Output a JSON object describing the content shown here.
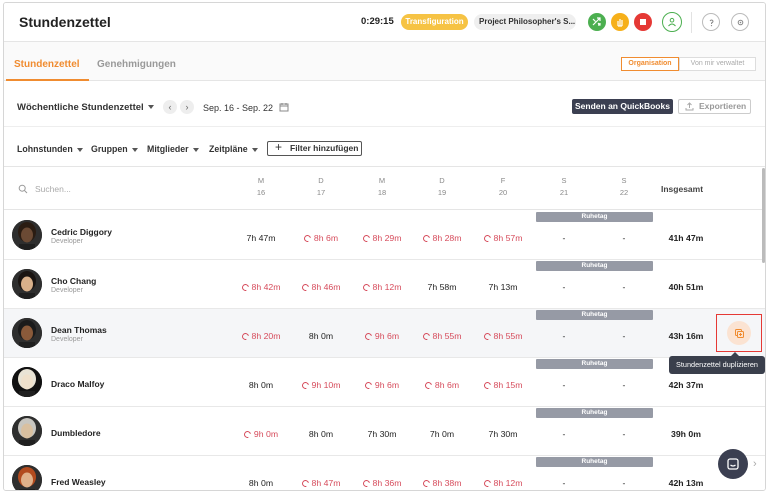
{
  "header": {
    "title": "Stundenzettel",
    "timer": "0:29:15",
    "current_task": "Transfiguration",
    "current_project": "Project Philosopher's S..."
  },
  "tabs": [
    {
      "label": "Stundenzettel",
      "active": true
    },
    {
      "label": "Genehmigungen",
      "active": false
    }
  ],
  "scope_toggle": {
    "options": [
      "Organisation",
      "Von mir verwaltet"
    ],
    "selected": "Organisation"
  },
  "toolbar": {
    "view_select": "Wöchentliche Stundenzettel",
    "date_range": "Sep. 16 - Sep. 22",
    "quickbooks_label": "Senden an QuickBooks",
    "export_label": "Exportieren"
  },
  "filters": {
    "items": [
      "Lohnstunden",
      "Gruppen",
      "Mitglieder",
      "Zeitpläne"
    ],
    "add_label": "Filter hinzufügen"
  },
  "table": {
    "search_placeholder": "Suchen...",
    "days": [
      {
        "letter": "M",
        "num": "16"
      },
      {
        "letter": "D",
        "num": "17"
      },
      {
        "letter": "M",
        "num": "18"
      },
      {
        "letter": "D",
        "num": "19"
      },
      {
        "letter": "F",
        "num": "20"
      },
      {
        "letter": "S",
        "num": "21"
      },
      {
        "letter": "S",
        "num": "22"
      }
    ],
    "total_header": "Insgesamt",
    "rest_label": "Ruhetag",
    "rows": [
      {
        "name": "Cedric Diggory",
        "role": "Developer",
        "hours": [
          "7h 47m",
          "8h 6m",
          "8h 29m",
          "8h 28m",
          "8h 57m",
          "-",
          "-"
        ],
        "over": [
          false,
          true,
          true,
          true,
          true,
          false,
          false
        ],
        "total": "41h 47m"
      },
      {
        "name": "Cho Chang",
        "role": "Developer",
        "hours": [
          "8h 42m",
          "8h 46m",
          "8h 12m",
          "7h 58m",
          "7h 13m",
          "-",
          "-"
        ],
        "over": [
          true,
          true,
          true,
          false,
          false,
          false,
          false
        ],
        "total": "40h 51m"
      },
      {
        "name": "Dean Thomas",
        "role": "Developer",
        "hours": [
          "8h 20m",
          "8h 0m",
          "9h 6m",
          "8h 55m",
          "8h 55m",
          "-",
          "-"
        ],
        "over": [
          true,
          false,
          true,
          true,
          true,
          false,
          false
        ],
        "total": "43h 16m"
      },
      {
        "name": "Draco Malfoy",
        "role": "",
        "hours": [
          "8h 0m",
          "9h 10m",
          "9h 6m",
          "8h 6m",
          "8h 15m",
          "-",
          "-"
        ],
        "over": [
          false,
          true,
          true,
          true,
          true,
          false,
          false
        ],
        "total": "42h 37m"
      },
      {
        "name": "Dumbledore",
        "role": "",
        "hours": [
          "9h 0m",
          "8h 0m",
          "7h 30m",
          "7h 0m",
          "7h 30m",
          "-",
          "-"
        ],
        "over": [
          true,
          false,
          false,
          false,
          false,
          false,
          false
        ],
        "total": "39h 0m"
      },
      {
        "name": "Fred Weasley",
        "role": "",
        "hours": [
          "8h 0m",
          "8h 47m",
          "8h 36m",
          "8h 38m",
          "8h 12m",
          "-",
          "-"
        ],
        "over": [
          false,
          true,
          true,
          true,
          true,
          false,
          false
        ],
        "total": "42h 13m"
      }
    ]
  },
  "tooltip": "Stundenzettel duplizieren",
  "colors": {
    "accent": "#f08c30",
    "overtime": "#d64b5b",
    "dark": "#3b3f51"
  }
}
